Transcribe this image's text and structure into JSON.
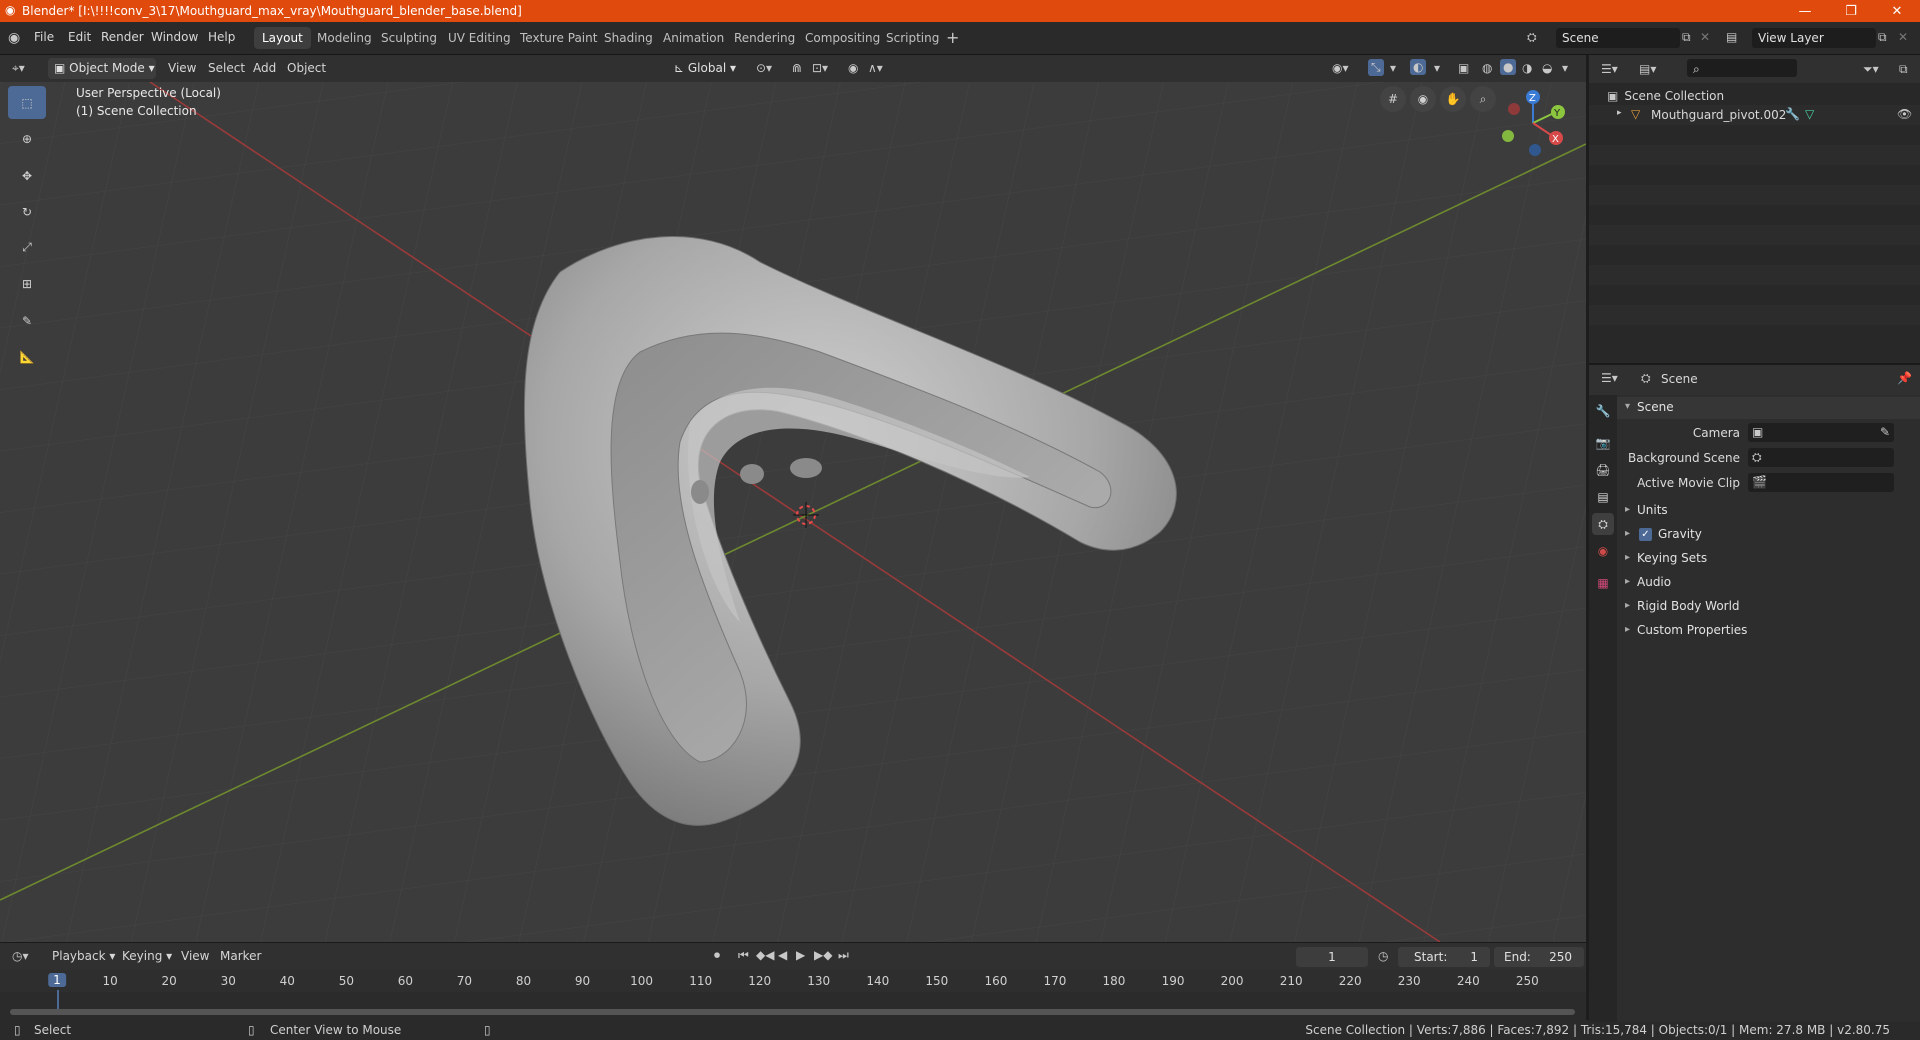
{
  "window": {
    "title": "Blender* [I:\\!!!!conv_3\\17\\Mouthguard_max_vray\\Mouthguard_blender_base.blend]",
    "minimize": "—",
    "restore": "❐",
    "close": "✕"
  },
  "menu": [
    "File",
    "Edit",
    "Render",
    "Window",
    "Help"
  ],
  "workspaces": [
    "Layout",
    "Modeling",
    "Sculpting",
    "UV Editing",
    "Texture Paint",
    "Shading",
    "Animation",
    "Rendering",
    "Compositing",
    "Scripting"
  ],
  "active_workspace": "Layout",
  "scene_field": "Scene",
  "view_layer_field": "View Layer",
  "viewport_header": {
    "mode": "Object Mode",
    "menus": [
      "View",
      "Select",
      "Add",
      "Object"
    ],
    "transform_orientation": "Global"
  },
  "viewport_info": {
    "line1": "User Perspective (Local)",
    "line2": "(1) Scene Collection"
  },
  "gizmo": {
    "x": "X",
    "y": "Y",
    "z": "Z"
  },
  "outliner": {
    "root": "Scene Collection",
    "items": [
      {
        "name": "Mouthguard_pivot.002"
      }
    ]
  },
  "properties": {
    "context": "Scene",
    "section": "Scene",
    "fields": [
      {
        "label": "Camera"
      },
      {
        "label": "Background Scene"
      },
      {
        "label": "Active Movie Clip"
      }
    ],
    "panels": [
      "Units",
      "Gravity",
      "Keying Sets",
      "Audio",
      "Rigid Body World",
      "Custom Properties"
    ],
    "gravity_checked": true
  },
  "timeline": {
    "menus": [
      "Playback",
      "Keying",
      "View",
      "Marker"
    ],
    "current_frame": "1",
    "start_label": "Start:",
    "start": "1",
    "end_label": "End:",
    "end": "250",
    "ticks": [
      "1",
      "10",
      "20",
      "30",
      "40",
      "50",
      "60",
      "70",
      "80",
      "90",
      "100",
      "110",
      "120",
      "130",
      "140",
      "150",
      "160",
      "170",
      "180",
      "190",
      "200",
      "210",
      "220",
      "230",
      "240",
      "250"
    ]
  },
  "status": {
    "left": "Select",
    "middle": "Center View to Mouse",
    "right": "Scene Collection | Verts:7,886 | Faces:7,892 | Tris:15,784 | Objects:0/1 | Mem: 27.8 MB | v2.80.75"
  },
  "colors": {
    "titlebar": "#e04a0c",
    "accent": "#4d6a96",
    "x_axis": "#d84a4a",
    "y_axis": "#8cc63f",
    "z_axis": "#3a7bd5"
  }
}
